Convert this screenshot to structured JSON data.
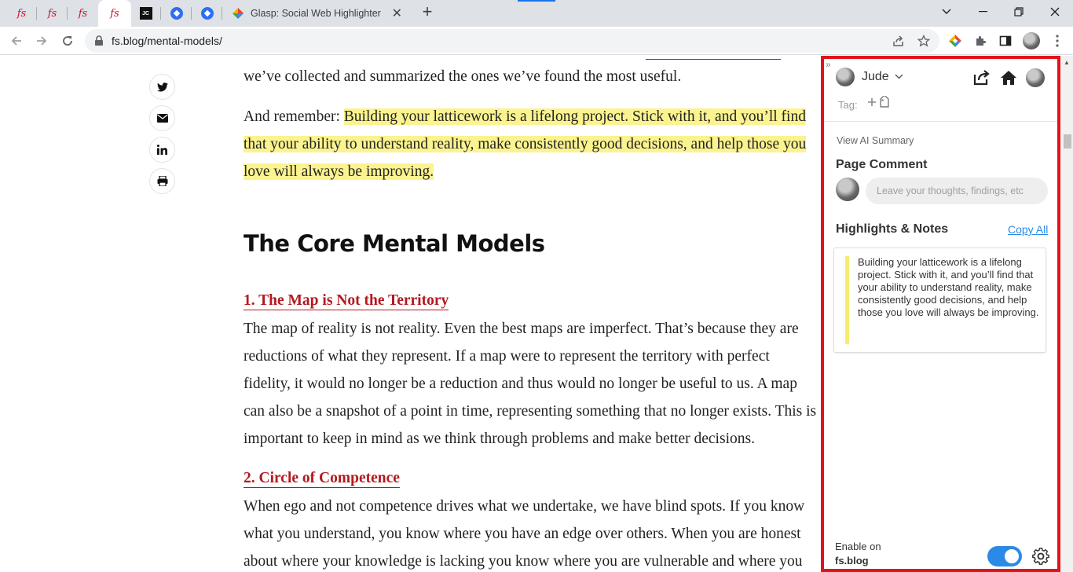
{
  "browser": {
    "tabs": [
      {
        "kind": "fs",
        "favicon_text": "fs"
      },
      {
        "kind": "fs",
        "favicon_text": "fs"
      },
      {
        "kind": "fs",
        "favicon_text": "fs"
      },
      {
        "kind": "fs",
        "favicon_text": "fs",
        "active": true
      },
      {
        "kind": "jc",
        "favicon_text": "JC"
      },
      {
        "kind": "diamond"
      },
      {
        "kind": "diamond"
      }
    ],
    "wide_tab_title": "Glasp: Social Web Highlighter",
    "url": "fs.blog/mental-models/"
  },
  "article": {
    "clipped_line": "we’ve collected and summarized the ones we’ve found the most useful.",
    "remember_prefix": "And remember: ",
    "remember_highlight": "Building your latticework is a lifelong project. Stick with it, and you’ll find that your ability to understand reality, make consistently good decisions, and help those you love will always be improving.",
    "heading": "The Core Mental Models",
    "section1_title": "1. The Map is Not the Territory",
    "section1_body": "The map of reality is not reality. Even the best maps are imperfect. That’s because they are reductions of what they represent. If a map were to represent the territory with perfect fidelity, it would no longer be a reduction and thus would no longer be useful to us. A map can also be a snapshot of a point in time, representing something that no longer exists. This is important to keep in mind as we think through problems and make better decisions.",
    "section2_title": "2. Circle of Competence",
    "section2_body": "When ego and not competence drives what we undertake, we have blind spots. If you know what you understand, you know where you have an edge over others. When you are honest about where your knowledge is lacking you know where you are vulnerable and where you"
  },
  "glasp": {
    "user_name": "Jude",
    "tag_label": "Tag:",
    "view_ai_summary": "View AI Summary",
    "page_comment_title": "Page Comment",
    "comment_placeholder": "Leave your thoughts, findings, etc",
    "highlights_title": "Highlights & Notes",
    "copy_all": "Copy All",
    "highlight_text": "Building your latticework is a lifelong project. Stick with it, and you’ll find that your ability to understand reality, make consistently good decisions, and help those you love will always be improving.",
    "enable_label": "Enable on",
    "enable_site": "fs.blog",
    "toggle_on": true
  },
  "colors": {
    "sidebar_border": "#e0131c",
    "highlight": "#fbf38f",
    "link_red": "#b3191f",
    "accent_blue": "#2b8ae6"
  }
}
